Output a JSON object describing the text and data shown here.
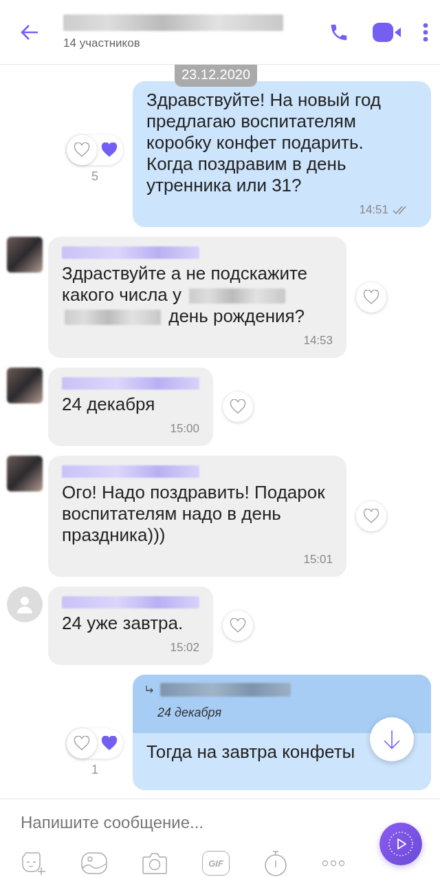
{
  "header": {
    "subtitle": "14 участников"
  },
  "date_badge": "23.12.2020",
  "messages": [
    {
      "kind": "outgoing",
      "segments": [
        {
          "kind": "text",
          "text": "Здравствуйте! На новый год предлагаю воспитателям коробку конфет подарить. Когда поздравим в день утренника или 31?"
        }
      ],
      "time": "14:51",
      "read": true,
      "liked": false,
      "reaction_count": "5"
    },
    {
      "kind": "incoming",
      "has_photo": true,
      "segments": [
        {
          "kind": "text",
          "text": "Здраствуйте а не подскажите"
        },
        {
          "kind": "text",
          "text": "какого числа у"
        },
        {
          "kind": "blurred"
        },
        {
          "kind": "blurred"
        },
        {
          "kind": "text",
          "text": "день рождения?"
        }
      ],
      "time": "14:53",
      "liked": false
    },
    {
      "kind": "incoming",
      "has_photo": true,
      "segments": [
        {
          "kind": "text",
          "text": "24 декабря"
        }
      ],
      "time": "15:00",
      "liked": false
    },
    {
      "kind": "incoming",
      "has_photo": true,
      "segments": [
        {
          "kind": "text",
          "text": "Ого! Надо поздравить! Подарок воспитателям надо в день праздника)))"
        }
      ],
      "time": "15:01",
      "liked": false
    },
    {
      "kind": "incoming",
      "has_photo": false,
      "segments": [
        {
          "kind": "text",
          "text": "24 уже завтра."
        }
      ],
      "time": "15:02",
      "liked": false
    },
    {
      "kind": "outgoing",
      "reply_date": "24 декабря",
      "segments": [
        {
          "kind": "text",
          "text": "Тогда на завтра конфеты"
        }
      ],
      "liked": false,
      "reaction_count": "1"
    }
  ],
  "composer": {
    "placeholder": "Напишите сообщение...",
    "gif_label": "GIF"
  }
}
